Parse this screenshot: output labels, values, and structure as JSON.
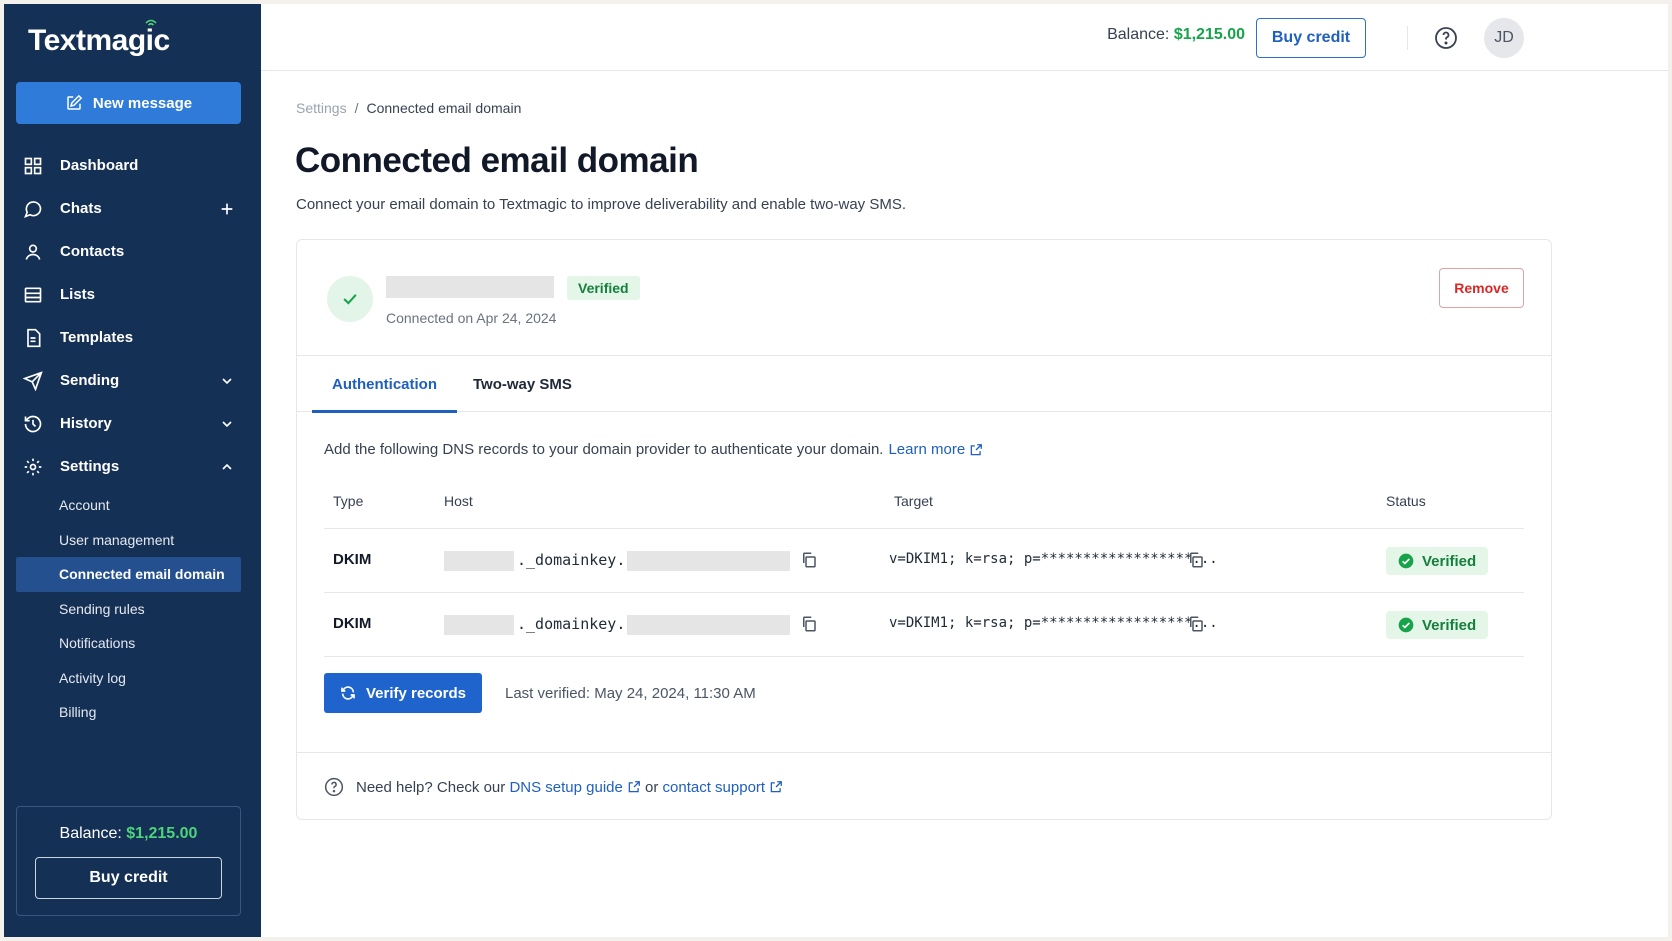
{
  "app": {
    "logo_text": "Textmagic"
  },
  "sidebar": {
    "new_message_label": "New message",
    "items": [
      {
        "label": "Dashboard"
      },
      {
        "label": "Chats"
      },
      {
        "label": "Contacts"
      },
      {
        "label": "Lists"
      },
      {
        "label": "Templates"
      },
      {
        "label": "Sending"
      },
      {
        "label": "History"
      },
      {
        "label": "Settings"
      }
    ],
    "settings_sub": [
      {
        "label": "Account"
      },
      {
        "label": "User management"
      },
      {
        "label": "Connected email domain"
      },
      {
        "label": "Sending rules"
      },
      {
        "label": "Notifications"
      },
      {
        "label": "Activity log"
      },
      {
        "label": "Billing"
      }
    ],
    "balance_label": "Balance:",
    "balance_amount": "$1,215.00",
    "buy_credit_label": "Buy credit"
  },
  "topbar": {
    "balance_label": "Balance:",
    "balance_amount": "$1,215.00",
    "buy_credit_label": "Buy credit",
    "avatar_initials": "JD"
  },
  "breadcrumb": {
    "parent": "Settings",
    "separator": "/",
    "current": "Connected email domain"
  },
  "page": {
    "title": "Connected email domain",
    "description": "Connect your email domain to Textmagic to improve deliverability and enable two-way SMS."
  },
  "domain": {
    "status_badge": "Verified",
    "connected_on": "Connected on Apr 24, 2024",
    "remove_label": "Remove"
  },
  "tabs": [
    {
      "label": "Authentication",
      "active": true
    },
    {
      "label": "Two-way SMS",
      "active": false
    }
  ],
  "dns": {
    "intro": "Add the following DNS records to your domain provider to authenticate your domain.",
    "learn_more": "Learn more",
    "columns": [
      "Type",
      "Host",
      "Target",
      "Status"
    ],
    "records": [
      {
        "type": "DKIM",
        "host_middle": "._domainkey.",
        "target": "v=DKIM1; k=rsa; p=******************...",
        "status": "Verified"
      },
      {
        "type": "DKIM",
        "host_middle": "._domainkey.",
        "target": "v=DKIM1; k=rsa; p=******************...",
        "status": "Verified"
      }
    ],
    "verify_label": "Verify records",
    "last_verified": "Last verified: May 24, 2024, 11:30 AM"
  },
  "help": {
    "prefix": "Need help? Check our",
    "guide_link": "DNS setup guide",
    "middle": "or",
    "support_link": "contact support"
  },
  "colors": {
    "sidebar_bg": "#153055",
    "accent": "#1f5fbf",
    "success": "#15803d",
    "danger": "#dc2626"
  }
}
